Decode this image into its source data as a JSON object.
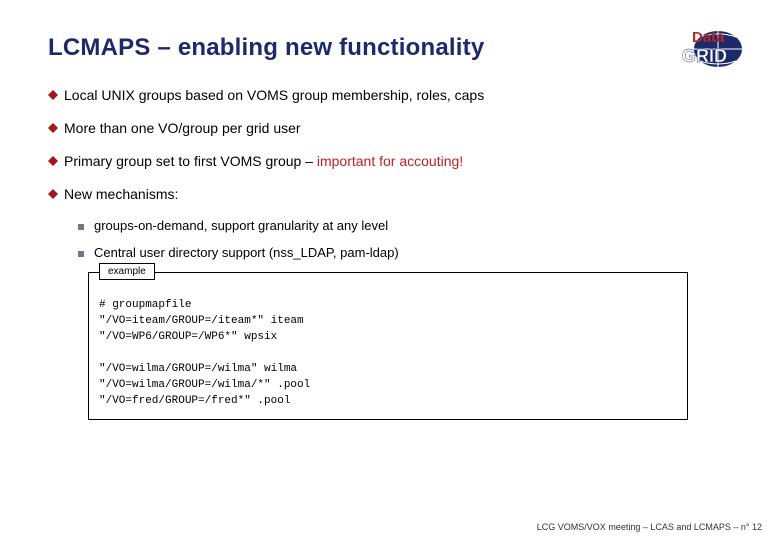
{
  "header": {
    "title": "LCMAPS – enabling new functionality",
    "logo": {
      "primary": "Data",
      "secondary": "GRID"
    }
  },
  "bullets": [
    {
      "text": "Local UNIX groups based on VOMS group membership, roles, caps"
    },
    {
      "text": "More than one VO/group per grid user"
    },
    {
      "prefix": "Primary group set to first VOMS group – ",
      "emph": "important for accouting!"
    },
    {
      "text": "New mechanisms:"
    }
  ],
  "sub_bullets": [
    "groups-on-demand, support granularity at any level",
    "Central user directory support (nss_LDAP, pam-ldap)"
  ],
  "example": {
    "label": "example",
    "lines": [
      "# groupmapfile",
      "\"/VO=iteam/GROUP=/iteam*\" iteam",
      "\"/VO=WP6/GROUP=/WP6*\" wpsix",
      "",
      "\"/VO=wilma/GROUP=/wilma\" wilma",
      "\"/VO=wilma/GROUP=/wilma/*\" .pool",
      "\"/VO=fred/GROUP=/fred*\" .pool"
    ]
  },
  "footer": "LCG VOMS/VOX meeting – LCAS and LCMAPS –  n° 12"
}
